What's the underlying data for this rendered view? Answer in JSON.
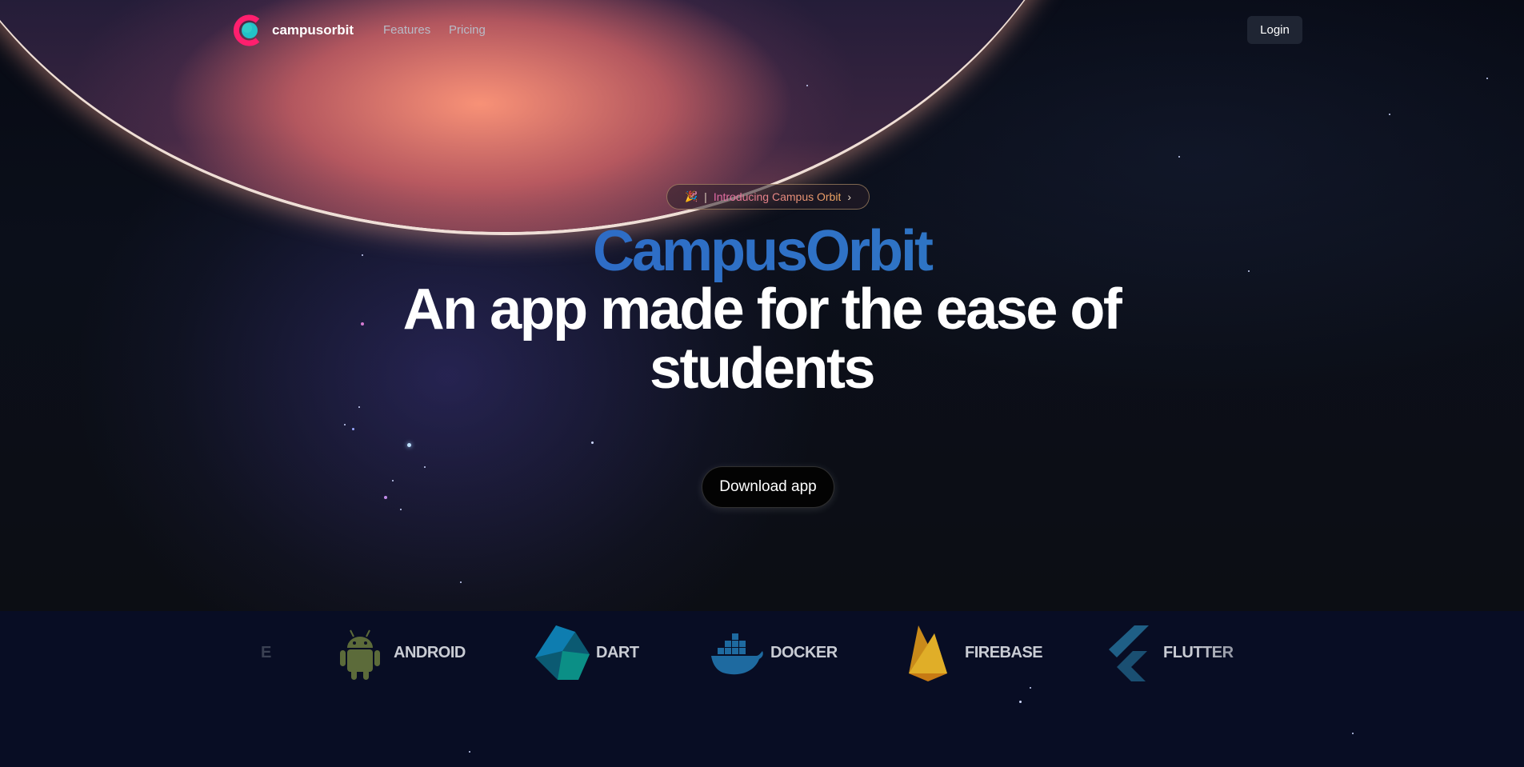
{
  "nav": {
    "brand": "campusorbit",
    "links": [
      "Features",
      "Pricing"
    ],
    "login_label": "Login"
  },
  "hero": {
    "badge": {
      "emoji": "🎉",
      "separator": "|",
      "text": "Introducing Campus Orbit",
      "chevron": "›"
    },
    "app_name": "CampusOrbit",
    "headline_line1": "An app made for the ease of",
    "headline_line2": "students",
    "cta_label": "Download app"
  },
  "tech_strip": {
    "items": [
      {
        "label": "E",
        "icon": "clipped-icon"
      },
      {
        "label": "ANDROID",
        "icon": "android-icon"
      },
      {
        "label": "DART",
        "icon": "dart-icon"
      },
      {
        "label": "DOCKER",
        "icon": "docker-icon"
      },
      {
        "label": "FIREBASE",
        "icon": "firebase-icon"
      },
      {
        "label": "FLUTTER",
        "icon": "flutter-icon"
      }
    ]
  },
  "colors": {
    "background": "#090c14",
    "strip_background": "#080d24",
    "app_name_gradient": [
      "#2a60c8",
      "#2a7fb8"
    ],
    "logo_outer": "#ff1f6e",
    "logo_inner": "#22c3c8",
    "login_button": "#1f2533"
  }
}
